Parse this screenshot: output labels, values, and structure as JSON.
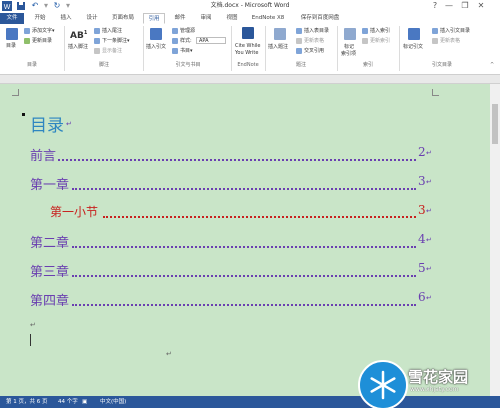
{
  "window": {
    "title": "文档.docx - Microsoft Word",
    "help": "?",
    "minimize": "—",
    "restore": "❐",
    "close": "✕"
  },
  "quick_access": {
    "save_icon": "save-icon",
    "undo_icon": "undo-icon",
    "redo_icon": "redo-icon"
  },
  "tabs": [
    "文件",
    "开始",
    "插入",
    "设计",
    "页面布局",
    "引用",
    "邮件",
    "审阅",
    "视图",
    "EndNote X8",
    "保存到百度网盘"
  ],
  "active_tab": "引用",
  "ribbon": {
    "toc_group": {
      "toc_button": "目录",
      "add_text": "添加文字▾",
      "update_table": "更新目录",
      "label": "目录"
    },
    "footnotes_group": {
      "insert_footnote": "插入脚注",
      "insert_endnote": "插入尾注",
      "next_footnote": "下一条脚注▾",
      "show_notes": "显示备注",
      "label": "脚注"
    },
    "citations_group": {
      "insert_citation": "插入引文",
      "manage_sources": "管理源",
      "style_label": "样式:",
      "style_value": "APA",
      "bibliography": "书目▾",
      "label": "引文与书目"
    },
    "endnote_group": {
      "cite_while": "Cite While",
      "you_write": "You Write",
      "label": "EndNote"
    },
    "captions_group": {
      "insert_caption": "插入题注",
      "insert_table_of_figures": "插入表目录",
      "update_table": "更新表格",
      "cross_reference": "交叉引用",
      "label": "题注"
    },
    "index_group": {
      "mark_entry_1": "标记",
      "mark_entry_2": "索引项",
      "insert_index": "插入索引",
      "update_index": "更新索引",
      "label": "索引"
    },
    "authorities_group": {
      "mark_citation": "标记引文",
      "insert_toa": "插入引文目录",
      "update_toa": "更新表格",
      "label": "引文目录"
    }
  },
  "document": {
    "toc_title": "目录",
    "entries": [
      {
        "text": "前言",
        "page": "2"
      },
      {
        "text": "第一章",
        "page": "3"
      },
      {
        "text": "第一小节",
        "page": "3"
      },
      {
        "text": "第二章",
        "page": "4"
      },
      {
        "text": "第三章",
        "page": "5"
      },
      {
        "text": "第四章",
        "page": "6"
      }
    ]
  },
  "status": {
    "page": "第 1 页，共 6 页",
    "words": "44 个字",
    "language": "中文(中国)"
  },
  "watermark": {
    "brand": "雪花家园",
    "url": "www.xhjaty.com"
  },
  "colors": {
    "accent": "#2b579a",
    "doc_bg": "#c9e5c8",
    "toc_text": "#6a3fb0",
    "subsection": "#c8201e",
    "title_blue": "#2e86c1"
  }
}
